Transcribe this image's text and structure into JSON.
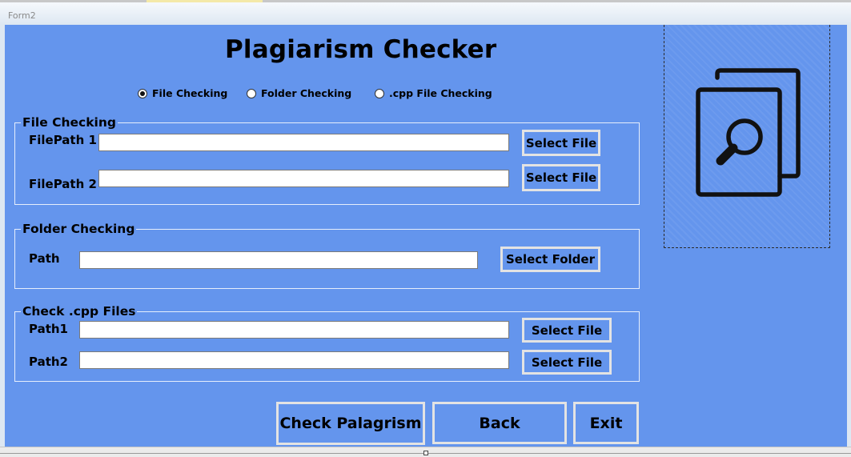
{
  "window": {
    "title": "Form2"
  },
  "header": {
    "title": "Plagiarism Checker"
  },
  "mode_options": [
    {
      "label": "File Checking",
      "checked": true
    },
    {
      "label": "Folder Checking",
      "checked": false
    },
    {
      "label": ".cpp File Checking",
      "checked": false
    }
  ],
  "file_checking": {
    "group_title": "File Checking",
    "path1_label": "FilePath 1",
    "path1_value": "",
    "path2_label": "FilePath 2",
    "path2_value": "",
    "select_file_1": "Select File",
    "select_file_2": "Select File"
  },
  "folder_checking": {
    "group_title": "Folder Checking",
    "path_label": "Path",
    "path_value": "",
    "select_folder": "Select Folder"
  },
  "cpp_checking": {
    "group_title": "Check .cpp Files",
    "path1_label": "Path1",
    "path1_value": "",
    "path2_label": "Path2",
    "path2_value": "",
    "select_file_1": "Select File",
    "select_file_2": "Select File"
  },
  "actions": {
    "check": "Check Palagrism",
    "back": "Back",
    "exit": "Exit"
  },
  "icon": "document-search-icon",
  "colors": {
    "background": "#6495ed",
    "button_border": "#e3e3e3"
  }
}
